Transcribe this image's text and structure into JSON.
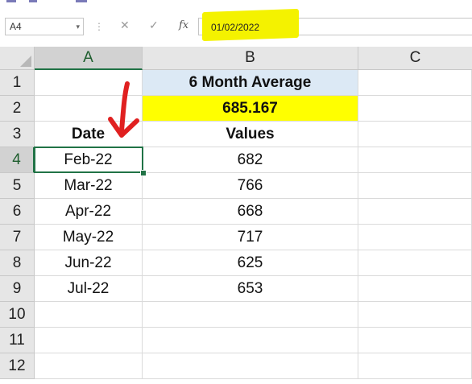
{
  "formula_bar": {
    "name_box": "A4",
    "name_box_dropdown_glyph": "▾",
    "separator_glyph": "⋮",
    "cancel_glyph": "✕",
    "enter_glyph": "✓",
    "fx_label": "fx",
    "content": "01/02/2022",
    "highlight_color": "#f4f200"
  },
  "columns": [
    "A",
    "B",
    "C"
  ],
  "rows": [
    "1",
    "2",
    "3",
    "4",
    "5",
    "6",
    "7",
    "8",
    "9",
    "10",
    "11",
    "12"
  ],
  "active_cell": {
    "column": "A",
    "row": "4"
  },
  "cells": {
    "b1": "6 Month Average",
    "b2": "685.167",
    "a3": "Date",
    "b3": "Values",
    "data": [
      {
        "date": "Feb-22",
        "value": "682"
      },
      {
        "date": "Mar-22",
        "value": "766"
      },
      {
        "date": "Apr-22",
        "value": "668"
      },
      {
        "date": "May-22",
        "value": "717"
      },
      {
        "date": "Jun-22",
        "value": "625"
      },
      {
        "date": "Jul-22",
        "value": "653"
      }
    ]
  },
  "colors": {
    "header_fill": "#dce9f5",
    "average_fill": "#ffff00",
    "selection": "#217346",
    "annotation_arrow": "#e02020"
  }
}
